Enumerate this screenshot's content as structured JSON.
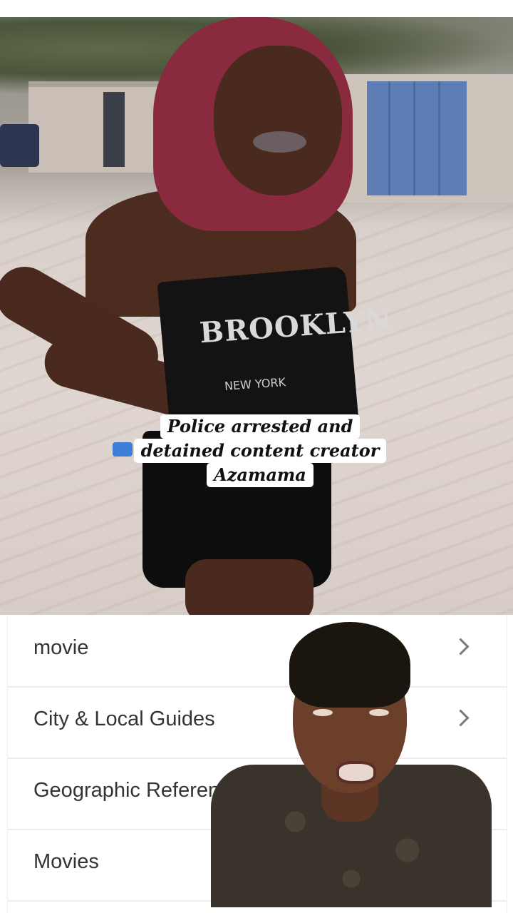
{
  "caption": {
    "lines": [
      "Police arrested and",
      "detained content creator",
      "Azamama"
    ]
  },
  "shirt_print": {
    "brand": "BROOKLYN",
    "city": "NEW YORK"
  },
  "list": {
    "items": [
      {
        "label": "movie"
      },
      {
        "label": "City & Local Guides"
      },
      {
        "label": "Geographic Reference"
      },
      {
        "label": "Movies"
      }
    ]
  },
  "icons": {
    "chevron": "chevron-right-icon"
  },
  "colors": {
    "caption_bg": "#ffffff",
    "caption_text": "#111111",
    "list_text": "#333333",
    "divider": "#ececec"
  }
}
